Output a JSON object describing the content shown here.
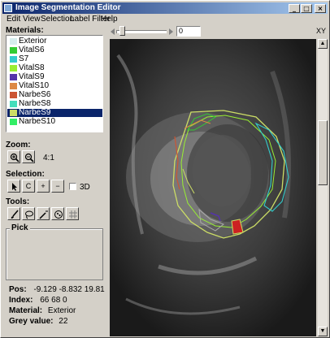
{
  "window": {
    "title": "Image Segmentation Editor",
    "buttons": {
      "minimize": "_",
      "maximize": "□",
      "close": "×"
    }
  },
  "menu": [
    "Edit",
    "View",
    "Selection",
    "Label Filter",
    "Help"
  ],
  "materials": {
    "label": "Materials:",
    "items": [
      {
        "label": "Exterior",
        "color": "#d6eeee"
      },
      {
        "label": "VitalS6",
        "color": "#33cc33"
      },
      {
        "label": "S7",
        "color": "#33cccc"
      },
      {
        "label": "VitalS8",
        "color": "#99ee33"
      },
      {
        "label": "VitalS9",
        "color": "#5533aa"
      },
      {
        "label": "VitalS10",
        "color": "#dd8844"
      },
      {
        "label": "NarbeS6",
        "color": "#cc5533"
      },
      {
        "label": "NarbeS8",
        "color": "#44ddbb"
      },
      {
        "label": "NarbeS9",
        "color": "#ccdd66",
        "selected": true
      },
      {
        "label": "NarbeS10",
        "color": "#33ee66"
      }
    ]
  },
  "zoom": {
    "label": "Zoom:",
    "value": "4:1",
    "icons": [
      "zoom-in-icon",
      "zoom-out-icon"
    ]
  },
  "selection": {
    "label": "Selection:",
    "buttons": {
      "pointer": "pointer-icon",
      "clear": "C",
      "add": "+",
      "remove": "−"
    },
    "checkbox_label": "3D",
    "checkbox_checked": false
  },
  "tools": {
    "label": "Tools:",
    "icons": [
      "brush-icon",
      "lasso-icon",
      "magic-wand-icon",
      "blob-icon",
      "crosshair-icon"
    ]
  },
  "pick": {
    "label": "Pick"
  },
  "info": {
    "pos_label": "Pos:",
    "pos_value": "-9.129 -8.832 19.81",
    "index_label": "Index:",
    "index_value": "66 68 0",
    "material_label": "Material:",
    "material_value": "Exterior",
    "grey_label": "Grey value:",
    "grey_value": "22"
  },
  "slice": {
    "value": "0",
    "xy_label": "XY"
  },
  "colors": {
    "accent": "#0a246a",
    "face": "#d4d0c8"
  }
}
